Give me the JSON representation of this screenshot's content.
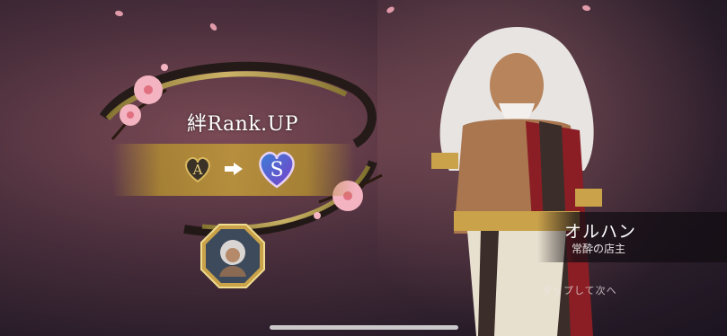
{
  "rank_up": {
    "title": "絆Rank.UP",
    "from_rank": "A",
    "to_rank": "S"
  },
  "character": {
    "name": "オルハン",
    "subtitle": "常酔の店主"
  },
  "prompt": {
    "tap_next": "タップして次へ"
  },
  "colors": {
    "gold": "#c9a24a",
    "heart_blue": "#3a7fd6",
    "heart_purple": "#7b3fc9",
    "sakura": "#f2a6b6"
  }
}
